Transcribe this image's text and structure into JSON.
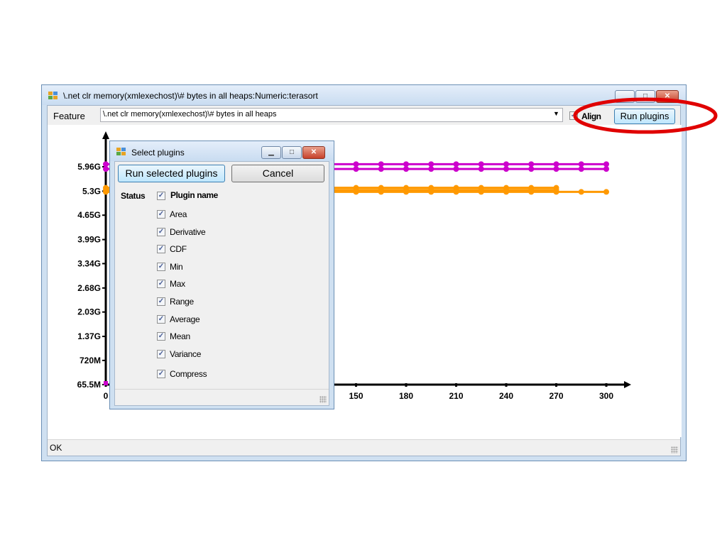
{
  "window": {
    "title": "\\.net clr memory(xmlexechost)\\# bytes in all heaps:Numeric:terasort",
    "controls": {
      "minimize": "▁",
      "maximize": "□",
      "close": "✕"
    }
  },
  "toolbar": {
    "feature_label": "Feature",
    "feature_value": "\\.net clr memory(xmlexechost)\\# bytes in all heaps",
    "align_checked": true,
    "align_label": "Align",
    "run_plugins_label": "Run plugins"
  },
  "status": {
    "text": "OK"
  },
  "dialog": {
    "title": "Select plugins",
    "run_selected_label": "Run selected plugins",
    "cancel_label": "Cancel",
    "header_status": "Status",
    "header_name": "Plugin name",
    "plugins": [
      {
        "name": "Area",
        "checked": true
      },
      {
        "name": "Derivative",
        "checked": true
      },
      {
        "name": "CDF",
        "checked": true
      },
      {
        "name": "Min",
        "checked": true
      },
      {
        "name": "Max",
        "checked": true
      },
      {
        "name": "Range",
        "checked": true
      },
      {
        "name": "Average",
        "checked": true
      },
      {
        "name": "Mean",
        "checked": true
      },
      {
        "name": "Variance",
        "checked": true
      },
      {
        "name": "Compress",
        "checked": true
      }
    ]
  },
  "chart_data": {
    "type": "line",
    "title": "",
    "xlabel": "",
    "ylabel": "",
    "y_tick_labels": [
      "65.5M",
      "720M",
      "1.37G",
      "2.03G",
      "2.68G",
      "3.34G",
      "3.99G",
      "4.65G",
      "5.3G",
      "5.96G"
    ],
    "y_tick_values": [
      0.0655,
      0.72,
      1.37,
      2.03,
      2.68,
      3.34,
      3.99,
      4.65,
      5.3,
      5.96
    ],
    "y_unit": "G",
    "x_tick_labels_visible": [
      "0",
      "150",
      "180",
      "210",
      "240",
      "270",
      "300"
    ],
    "x_tick_values_visible": [
      0,
      150,
      180,
      210,
      240,
      270,
      300
    ],
    "xlim": [
      0,
      300
    ],
    "ylim": [
      0.0655,
      5.96
    ],
    "series": [
      {
        "color": "#cc00cc",
        "x": [
          0,
          15,
          30,
          45,
          60,
          75,
          90,
          105,
          120,
          135,
          150,
          165,
          180,
          195,
          210,
          225,
          240,
          255,
          270,
          285,
          300
        ],
        "y": [
          6.03,
          6.03,
          6.03,
          6.03,
          6.03,
          6.03,
          6.03,
          6.03,
          6.03,
          6.03,
          6.03,
          6.03,
          6.03,
          6.03,
          6.03,
          6.03,
          6.03,
          6.03,
          6.03,
          6.03,
          6.03
        ]
      },
      {
        "color": "#cc00cc",
        "x": [
          0,
          15,
          30,
          45,
          60,
          75,
          90,
          105,
          120,
          135,
          150,
          165,
          180,
          195,
          210,
          225,
          240,
          255,
          270,
          285,
          300
        ],
        "y": [
          5.9,
          5.9,
          5.9,
          5.9,
          5.9,
          5.9,
          5.9,
          5.9,
          5.9,
          5.9,
          5.9,
          5.9,
          5.9,
          5.9,
          5.9,
          5.9,
          5.9,
          5.9,
          5.9,
          5.9,
          5.9
        ]
      },
      {
        "color": "#ff9900",
        "x": [
          0,
          15,
          30,
          45,
          60,
          75,
          90,
          105,
          120,
          135,
          150,
          165,
          180,
          195,
          210,
          225,
          240,
          255,
          270
        ],
        "y": [
          5.39,
          5.39,
          5.39,
          5.39,
          5.39,
          5.39,
          5.39,
          5.39,
          5.39,
          5.39,
          5.39,
          5.39,
          5.39,
          5.39,
          5.39,
          5.39,
          5.39,
          5.39,
          5.39
        ]
      },
      {
        "color": "#ff9900",
        "x": [
          0,
          15,
          30,
          45,
          60,
          75,
          90,
          105,
          120,
          135,
          150,
          165,
          180,
          195,
          210,
          225,
          240,
          255,
          270
        ],
        "y": [
          5.33,
          5.33,
          5.33,
          5.33,
          5.33,
          5.33,
          5.33,
          5.33,
          5.33,
          5.33,
          5.33,
          5.33,
          5.33,
          5.33,
          5.33,
          5.33,
          5.33,
          5.33,
          5.33
        ]
      },
      {
        "color": "#ff9900",
        "x": [
          0,
          15,
          30,
          45,
          60,
          75,
          90,
          105,
          120,
          135,
          150,
          165,
          180,
          195,
          210,
          225,
          240,
          255,
          270,
          285,
          300
        ],
        "y": [
          5.28,
          5.28,
          5.28,
          5.28,
          5.28,
          5.28,
          5.28,
          5.28,
          5.28,
          5.28,
          5.28,
          5.28,
          5.28,
          5.28,
          5.28,
          5.28,
          5.28,
          5.28,
          5.28,
          5.28,
          5.28
        ]
      }
    ],
    "grid": false
  },
  "annotation": {
    "shape": "ellipse",
    "color": "#e00000",
    "target": "Run plugins"
  }
}
